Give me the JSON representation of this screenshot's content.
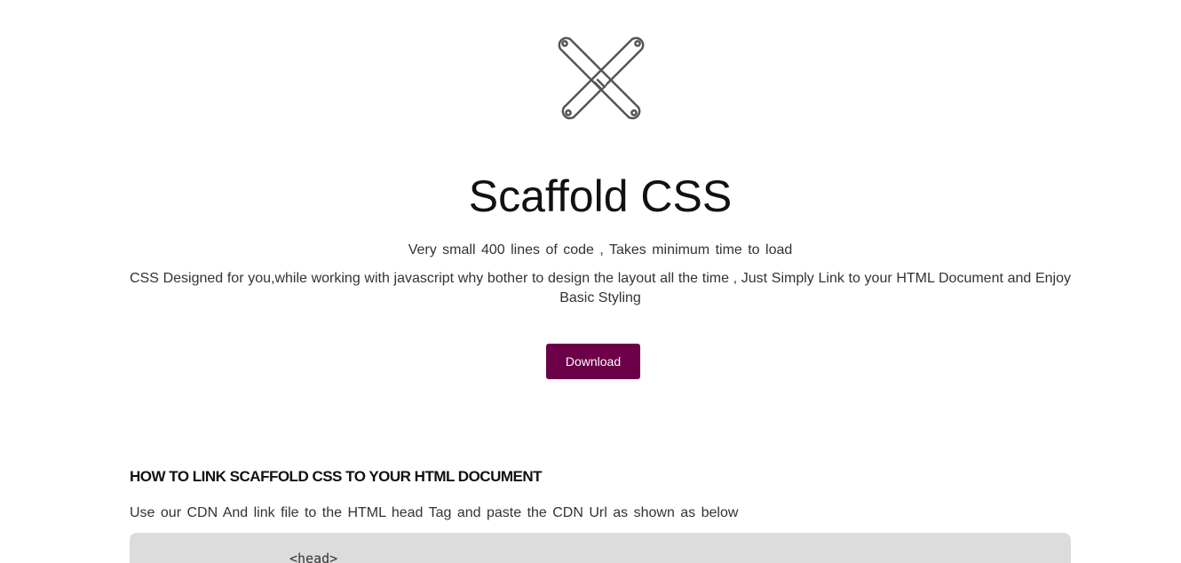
{
  "logo": {
    "icon": "crossed-wrenches-icon",
    "stroke_color": "#555555"
  },
  "hero": {
    "title": "Scaffold CSS",
    "tagline": "Very small 400 lines of code , Takes minimum time to load",
    "description": "CSS Designed for you,while working with javascript why bother to design the layout all the time , Just Simply Link to your HTML Document and Enjoy Basic Styling",
    "download_label": "Download",
    "button_color": "#6b0048"
  },
  "howto": {
    "heading": "HOW TO LINK SCAFFOLD CSS TO YOUR HTML DOCUMENT",
    "text": "Use our CDN And link file to the HTML head Tag and paste the CDN Url as shown as below",
    "code_first_line": "<head>"
  }
}
